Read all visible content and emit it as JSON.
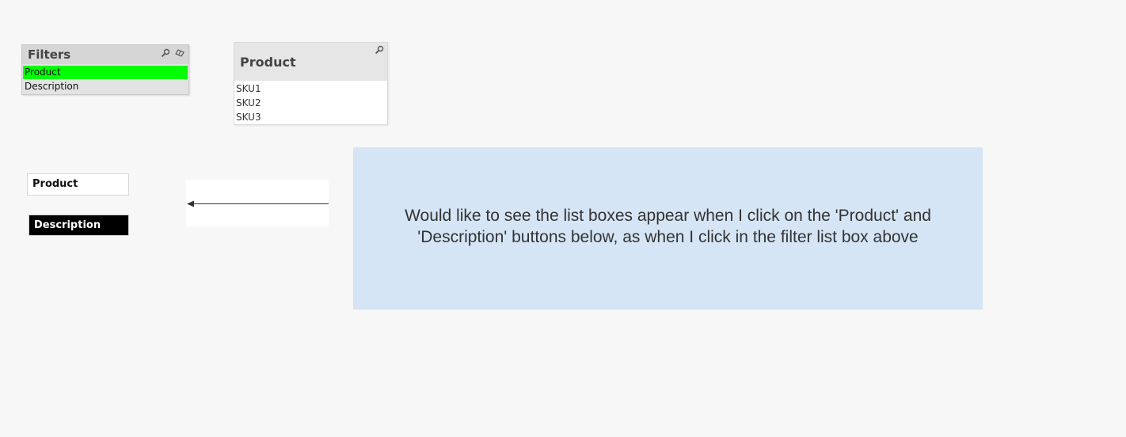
{
  "filters": {
    "title": "Filters",
    "search_icon": "search-icon",
    "eraser_icon": "eraser-icon",
    "items": [
      {
        "label": "Product",
        "selected": true
      },
      {
        "label": "Description",
        "selected": false
      }
    ],
    "selected_color": "#00ff00"
  },
  "product_listbox": {
    "title": "Product",
    "search_icon": "search-icon",
    "items": [
      "SKU1",
      "SKU2",
      "SKU3"
    ]
  },
  "buttons": {
    "product_label": "Product",
    "description_label": "Description"
  },
  "note": {
    "text": "Would like to see the list boxes appear when I click on the 'Product' and\n'Description' buttons below,  as when I click in the filter list box above",
    "background": "#d5e5f5"
  }
}
